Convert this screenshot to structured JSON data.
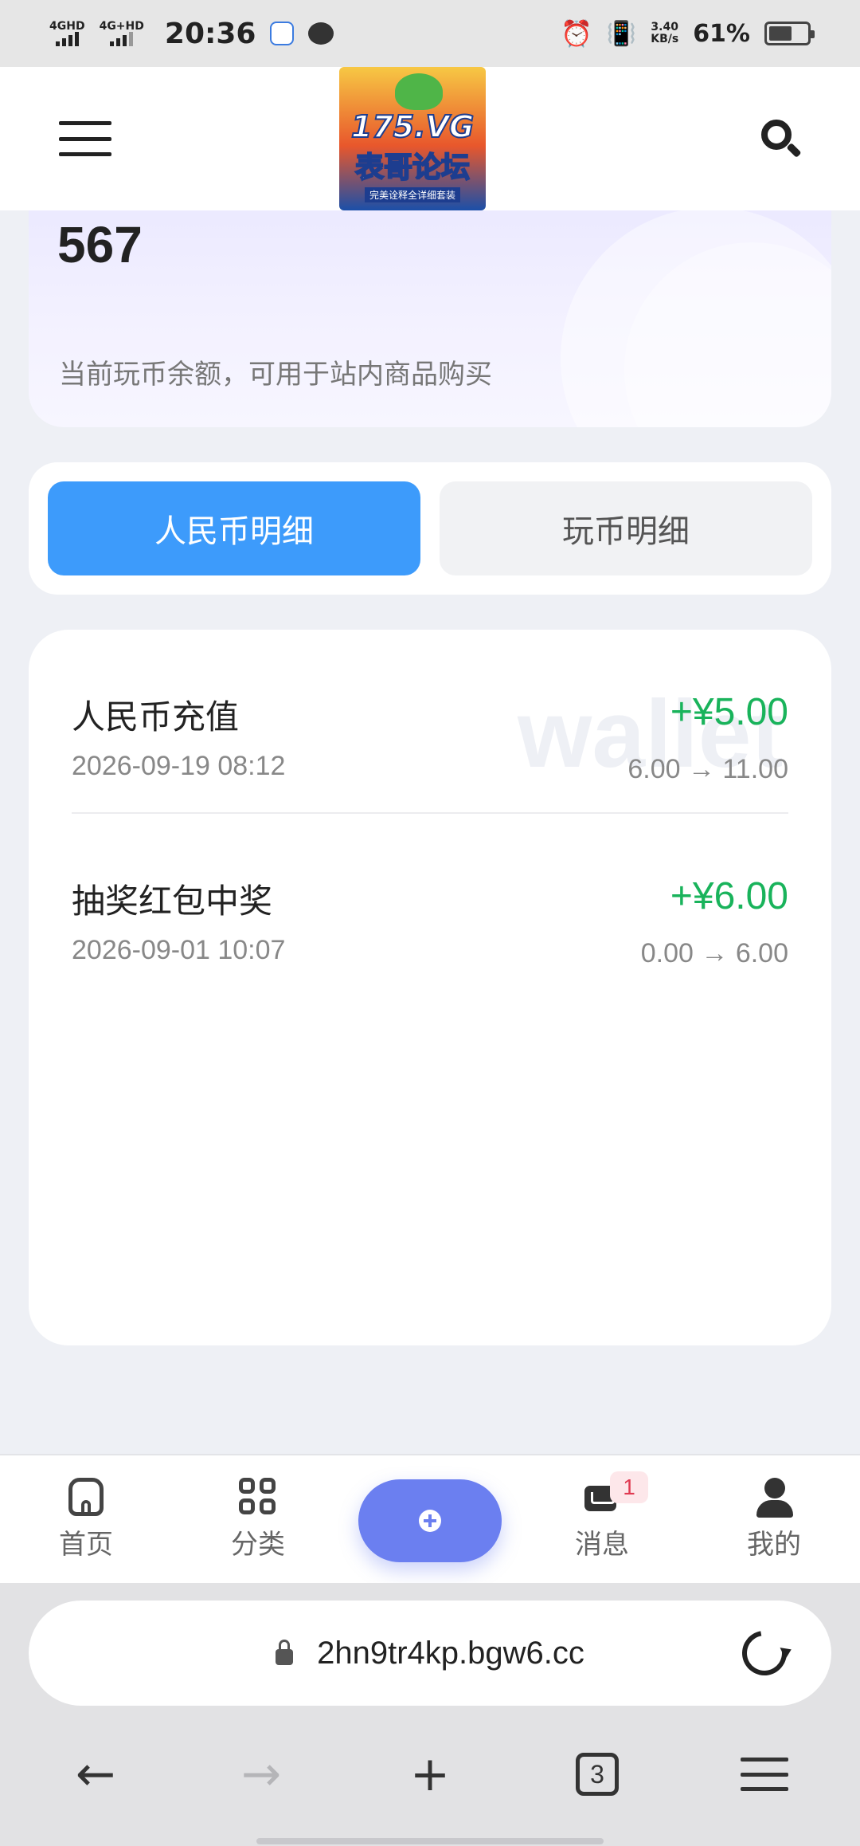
{
  "status_bar": {
    "signal1": "4GHD",
    "signal2": "4G+HD",
    "time": "20:36",
    "net_speed_value": "3.40",
    "net_speed_unit": "KB/s",
    "battery_pct": "61%"
  },
  "header": {
    "logo_line1": "175.VG",
    "logo_line2": "表哥论坛",
    "logo_line3": "完美诠释全详细套装"
  },
  "balance": {
    "value": "567",
    "note": "当前玩币余额，可用于站内商品购买"
  },
  "tabs": [
    {
      "label": "人民币明细",
      "active": true
    },
    {
      "label": "玩币明细",
      "active": false
    }
  ],
  "watermark": "wallet",
  "transactions": [
    {
      "title": "人民币充值",
      "time": "2026-09-19 08:12",
      "amount": "+¥5.00",
      "change": "6.00 → 11.00"
    },
    {
      "title": "抽奖红包中奖",
      "time": "2026-09-01 10:07",
      "amount": "+¥6.00",
      "change": "0.00 → 6.00"
    }
  ],
  "bottom_nav": {
    "home": "首页",
    "category": "分类",
    "messages": "消息",
    "messages_badge": "1",
    "mine": "我的"
  },
  "browser": {
    "url": "2hn9tr4kp.bgw6.cc",
    "back_glyph": "←",
    "forward_glyph": "→",
    "new_tab_glyph": "+",
    "tab_count": "3"
  },
  "colors": {
    "accent_blue": "#3d9bfb",
    "fab_purple": "#6b7ff0",
    "amount_green": "#19b35b"
  }
}
